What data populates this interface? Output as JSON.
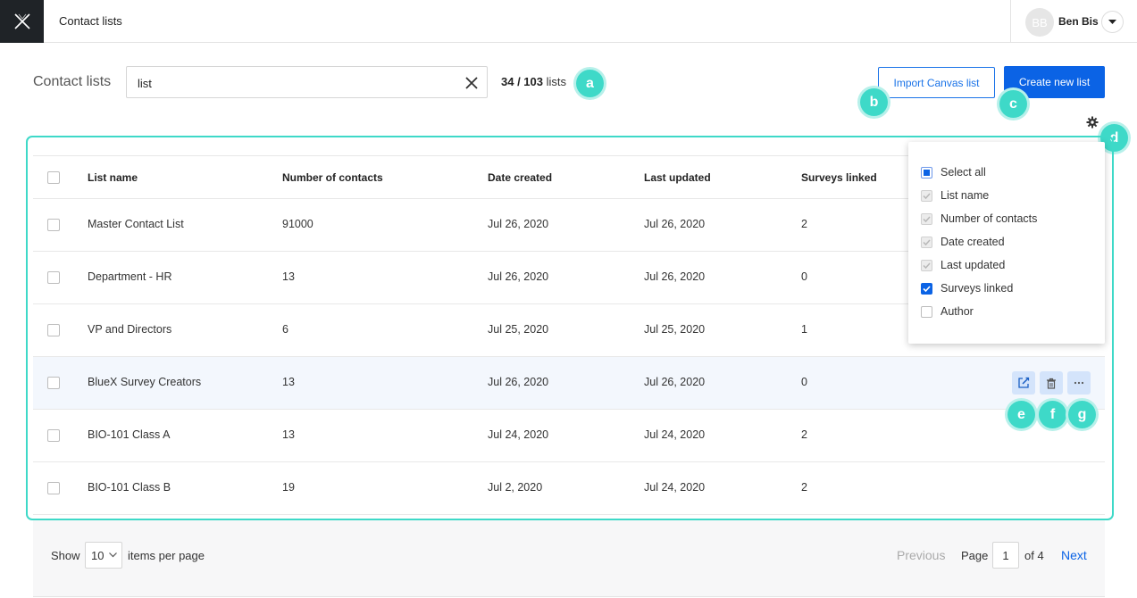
{
  "topbar": {
    "app_title": "Contact lists",
    "user_initials": "BB",
    "user_name": "Ben Bis"
  },
  "header": {
    "page_title": "Contact lists",
    "search_value": "list",
    "count_shown": "34 / 103",
    "count_suffix": "lists",
    "import_button": "Import Canvas list",
    "create_button": "Create new list"
  },
  "markers": [
    "a",
    "b",
    "c",
    "d",
    "e",
    "f",
    "g"
  ],
  "table": {
    "columns": [
      "List name",
      "Number of contacts",
      "Date created",
      "Last updated",
      "Surveys linked"
    ],
    "rows": [
      {
        "name": "Master Contact List",
        "contacts": "91000",
        "created": "Jul 26, 2020",
        "updated": "Jul 26, 2020",
        "surveys": "2"
      },
      {
        "name": "Department - HR",
        "contacts": "13",
        "created": "Jul 26, 2020",
        "updated": "Jul 26, 2020",
        "surveys": "0"
      },
      {
        "name": "VP and Directors",
        "contacts": "6",
        "created": "Jul 25, 2020",
        "updated": "Jul 25, 2020",
        "surveys": "1"
      },
      {
        "name": "BlueX Survey Creators",
        "contacts": "13",
        "created": "Jul 26, 2020",
        "updated": "Jul 26, 2020",
        "surveys": "0"
      },
      {
        "name": "BIO-101 Class A",
        "contacts": "13",
        "created": "Jul 24, 2020",
        "updated": "Jul 24, 2020",
        "surveys": "2"
      },
      {
        "name": "BIO-101 Class B",
        "contacts": "19",
        "created": "Jul 2, 2020",
        "updated": "Jul 24, 2020",
        "surveys": "2"
      }
    ]
  },
  "column_menu": {
    "items": [
      {
        "label": "Select all",
        "state": "partial"
      },
      {
        "label": "List name",
        "state": "disabled"
      },
      {
        "label": "Number of contacts",
        "state": "disabled"
      },
      {
        "label": "Date created",
        "state": "disabled"
      },
      {
        "label": "Last updated",
        "state": "disabled"
      },
      {
        "label": "Surveys linked",
        "state": "checked"
      },
      {
        "label": "Author",
        "state": "empty"
      }
    ]
  },
  "footer": {
    "show_label": "Show",
    "per_page_value": "10",
    "per_page_suffix": "items per page",
    "previous_label": "Previous",
    "page_label": "Page",
    "page_value": "1",
    "of_label": "of 4",
    "next_label": "Next"
  },
  "colors": {
    "accent": "#0b63e5",
    "annotation": "#3ed9c8",
    "logo_bg": "#1f2327"
  }
}
